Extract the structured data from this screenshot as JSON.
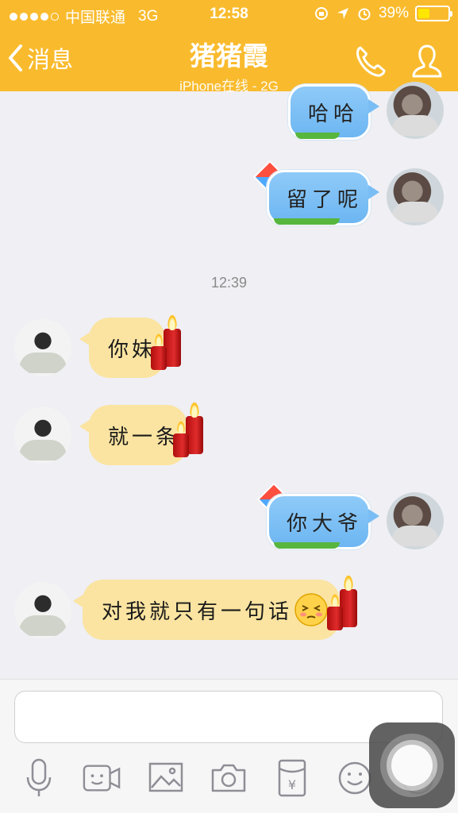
{
  "status_bar": {
    "carrier": "中国联通",
    "network": "3G",
    "time": "12:58",
    "battery_percent": "39%",
    "battery_level": 0.39,
    "signal_dots_filled": 4
  },
  "header": {
    "back_label": "消息",
    "contact_name": "猪猪霞",
    "contact_status": "iPhone在线 - 2G"
  },
  "messages": [
    {
      "side": "out",
      "text": "哈哈"
    },
    {
      "side": "out",
      "text": "留了呢"
    },
    {
      "side": "in",
      "text": "你妹"
    },
    {
      "side": "in",
      "text": "就一条"
    },
    {
      "side": "out",
      "text": "你大爷"
    },
    {
      "side": "in",
      "text": "对我就只有一句话"
    }
  ],
  "timestamp": "12:39",
  "input": {
    "placeholder": "",
    "value": ""
  },
  "toolbar": [
    {
      "name": "microphone-icon"
    },
    {
      "name": "video-call-icon"
    },
    {
      "name": "image-icon"
    },
    {
      "name": "camera-icon"
    },
    {
      "name": "red-packet-icon"
    },
    {
      "name": "emoji-icon"
    },
    {
      "name": "plus-icon"
    }
  ],
  "colors": {
    "header": "#f9bb2d",
    "bubble_out": "#7cbcf4",
    "bubble_in": "#fbe4a1",
    "background": "#efeff4"
  }
}
